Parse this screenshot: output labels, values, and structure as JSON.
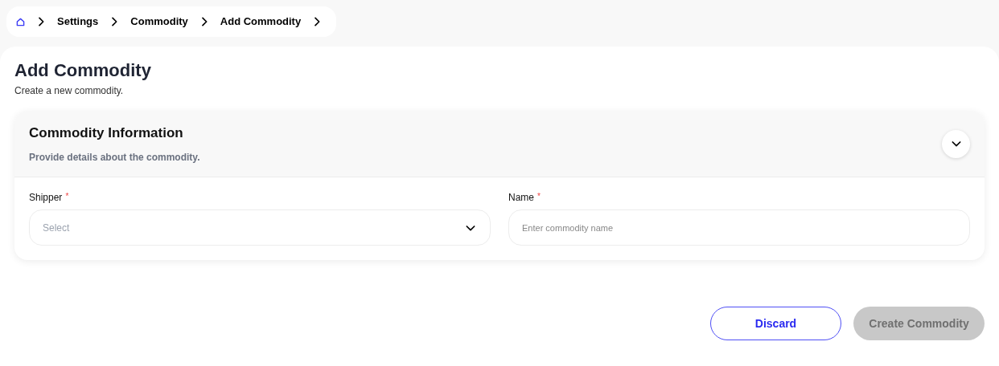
{
  "breadcrumb": [
    {
      "label": "Settings"
    },
    {
      "label": "Commodity"
    },
    {
      "label": "Add Commodity"
    }
  ],
  "page": {
    "title": "Add Commodity",
    "subtitle": "Create a new commodity."
  },
  "section": {
    "title": "Commodity Information",
    "description": "Provide details about the commodity.",
    "expanded": true
  },
  "fields": [
    {
      "label": "Shipper",
      "required_mark": "*",
      "kind": "select",
      "placeholder": "Select"
    },
    {
      "label": "Name",
      "required_mark": "*",
      "kind": "text",
      "placeholder": "Enter commodity name"
    }
  ],
  "buttons": [
    {
      "label": "Discard",
      "kind": "outline",
      "disabled": false
    },
    {
      "label": "Create Commodity",
      "kind": "primary",
      "disabled": true
    }
  ]
}
